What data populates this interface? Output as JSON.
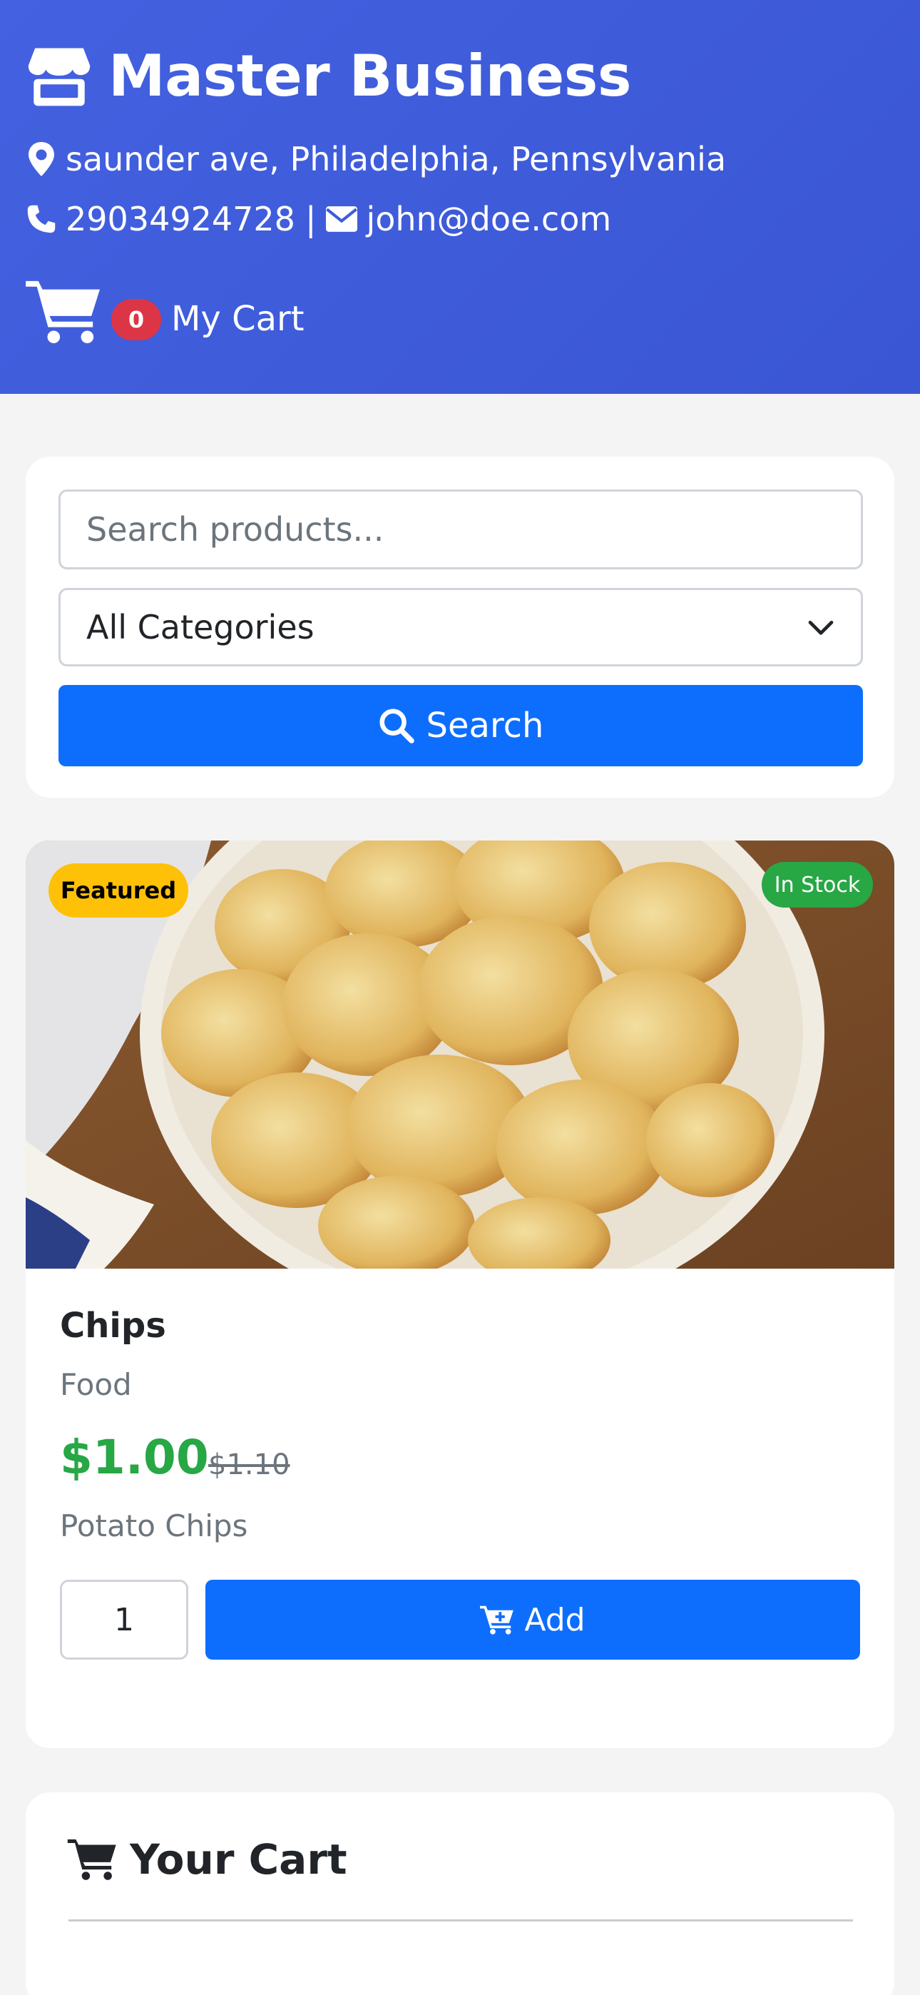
{
  "header": {
    "business_name": "Master Business",
    "address": "saunder ave, Philadelphia, Pennsylvania",
    "phone": "29034924728",
    "separator": "|",
    "email": "john@doe.com",
    "cart_count": "0",
    "cart_label": "My Cart"
  },
  "search": {
    "placeholder": "Search products...",
    "category_selected": "All Categories",
    "button_label": "Search"
  },
  "product": {
    "badge_featured": "Featured",
    "badge_stock": "In Stock",
    "name": "Chips",
    "category": "Food",
    "price": "$1.00",
    "old_price": "$1.10",
    "description": "Potato Chips",
    "quantity": "1",
    "add_label": "Add"
  },
  "cart": {
    "title": "Your Cart"
  },
  "colors": {
    "header_bg": "#4361e0",
    "primary": "#0d6efd",
    "success": "#28a745",
    "warning": "#ffc107",
    "danger": "#dc3545"
  },
  "icons": [
    "store-icon",
    "map-marker-icon",
    "phone-icon",
    "envelope-icon",
    "shopping-cart-icon",
    "search-icon",
    "chevron-down-icon",
    "cart-plus-icon"
  ]
}
